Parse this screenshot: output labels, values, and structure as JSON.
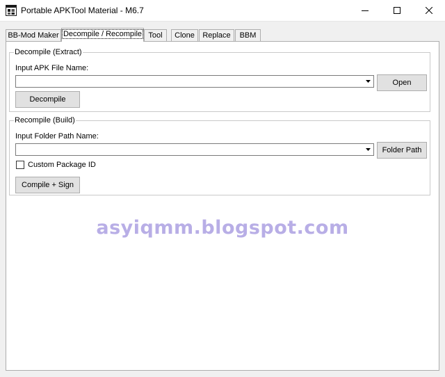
{
  "window": {
    "title": "Portable APKTool Material - M6.7",
    "icon": "app-window-icon"
  },
  "tabs": [
    {
      "label": "BB-Mod Maker",
      "active": false
    },
    {
      "label": "Decompile / Recompile",
      "active": true
    },
    {
      "label": "Tool",
      "active": false
    },
    {
      "label": "Clone",
      "active": false
    },
    {
      "label": "Replace",
      "active": false
    },
    {
      "label": "BBM",
      "active": false
    }
  ],
  "decompile": {
    "group_label": "Decompile (Extract)",
    "input_label": "Input APK File Name:",
    "input_value": "",
    "open_button": "Open",
    "decompile_button": "Decompile"
  },
  "recompile": {
    "group_label": "Recompile (Build)",
    "input_label": "Input Folder Path Name:",
    "input_value": "",
    "folder_button": "Folder Path",
    "checkbox_label": "Custom Package ID",
    "checkbox_checked": false,
    "compile_button": "Compile + Sign"
  },
  "watermark": "asyiqmm.blogspot.com"
}
